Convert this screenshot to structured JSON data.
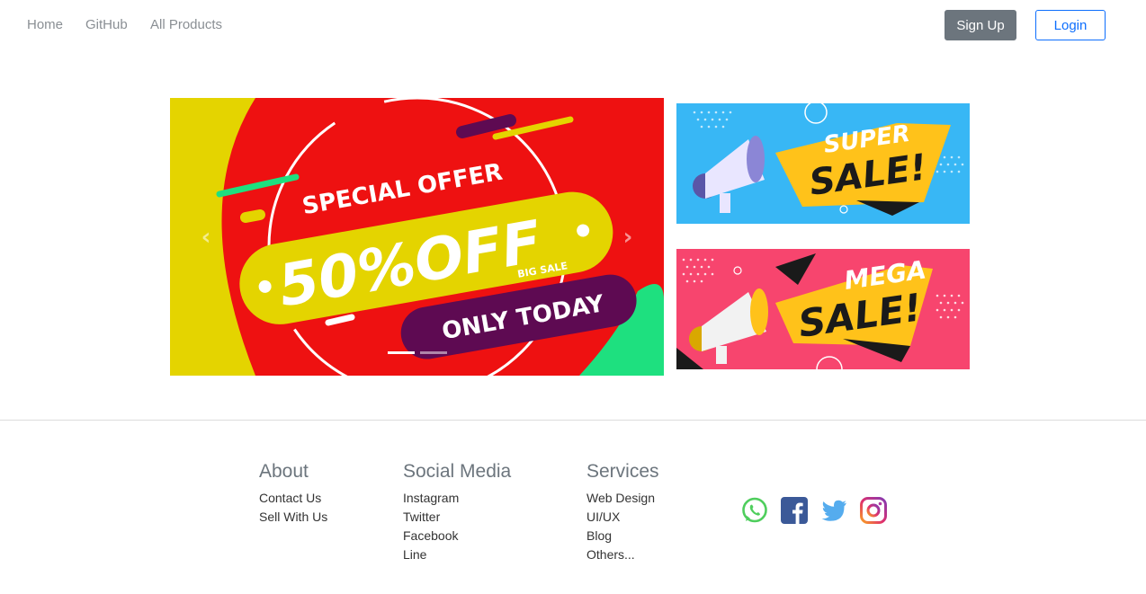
{
  "nav": {
    "links": [
      "Home",
      "GitHub",
      "All Products"
    ],
    "signup_label": "Sign Up",
    "login_label": "Login"
  },
  "carousel": {
    "slide": {
      "line1": "SPECIAL OFFER",
      "line2": "50%OFF",
      "line3": "BIG SALE",
      "line4": "ONLY TODAY"
    },
    "prev_icon": "chevron-left-icon",
    "next_icon": "chevron-right-icon",
    "indicator_count": 2,
    "active_index": 0
  },
  "banners": {
    "super": {
      "line1": "SUPER",
      "line2": "SALE!"
    },
    "mega": {
      "line1": "MEGA",
      "line2": "SALE!"
    }
  },
  "footer": {
    "about": {
      "title": "About",
      "links": [
        "Contact Us",
        "Sell With Us"
      ]
    },
    "social_media": {
      "title": "Social Media",
      "links": [
        "Instagram",
        "Twitter",
        "Facebook",
        "Line"
      ]
    },
    "services": {
      "title": "Services",
      "links": [
        "Web Design",
        "UI/UX",
        "Blog",
        "Others..."
      ]
    },
    "icons": [
      "whatsapp-icon",
      "facebook-icon",
      "twitter-icon",
      "instagram-icon"
    ]
  },
  "colors": {
    "primary": "#0d6efd",
    "secondary": "#6c757d",
    "carousel_red": "#ee1111",
    "yellow": "#e4d400",
    "purple": "#5e0a52",
    "green": "#1ee07f"
  }
}
